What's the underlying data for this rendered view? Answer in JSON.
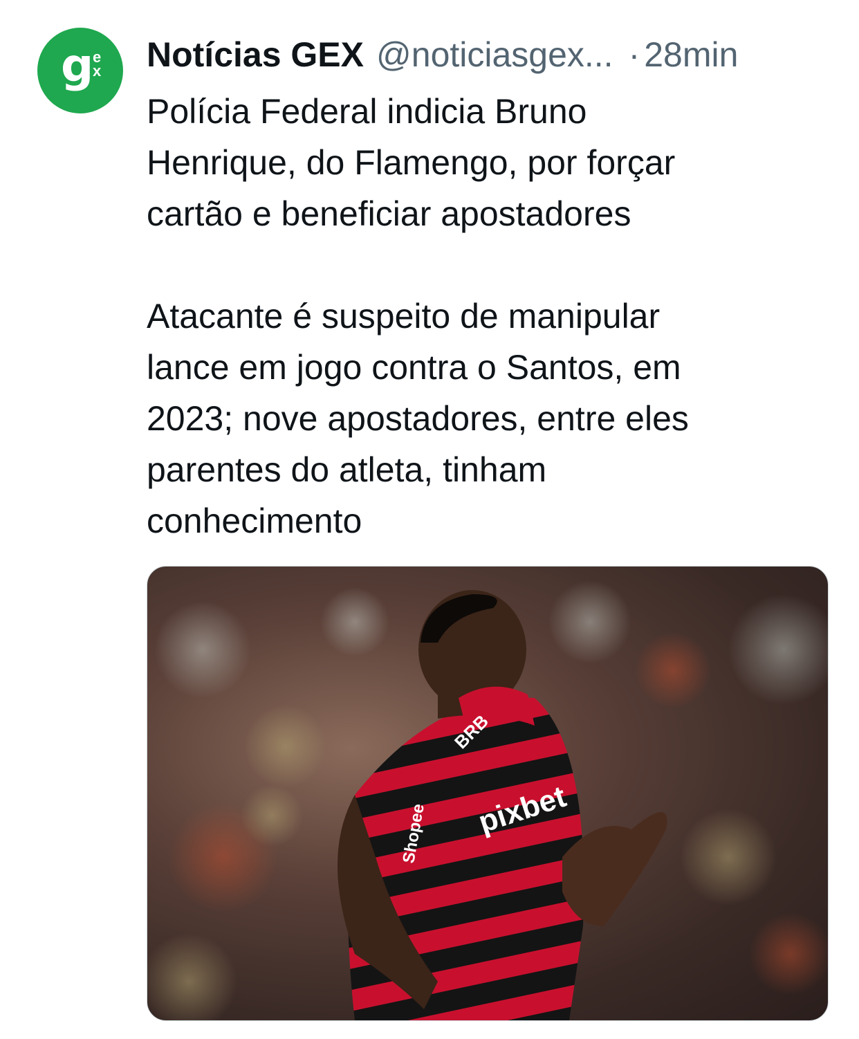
{
  "account": {
    "name": "Notícias GEX",
    "handle": "@noticiasgex...",
    "separator": "·",
    "time": "28min",
    "avatar_letters": {
      "g": "g",
      "e": "e",
      "x": "x"
    }
  },
  "post": {
    "headline_lines": [
      "Polícia Federal indicia Bruno",
      "Henrique, do Flamengo, por forçar",
      "cartão e beneficiar apostadores"
    ],
    "body_lines": [
      "Atacante é suspeito de manipular",
      "lance em jogo contra o Santos, em",
      "2023; nove apostadores, entre eles",
      "parentes do atleta, tinham",
      "conhecimento"
    ]
  },
  "media": {
    "jersey_texts": {
      "sponsor_top": "BRB",
      "sponsor_chest": "pixbet",
      "sponsor_side": "Shopee"
    }
  },
  "colors": {
    "avatar_bg": "#1fa84f",
    "text_primary": "#0f1419",
    "text_secondary": "#536471",
    "jersey_red": "#c8102e",
    "jersey_black": "#111111"
  }
}
